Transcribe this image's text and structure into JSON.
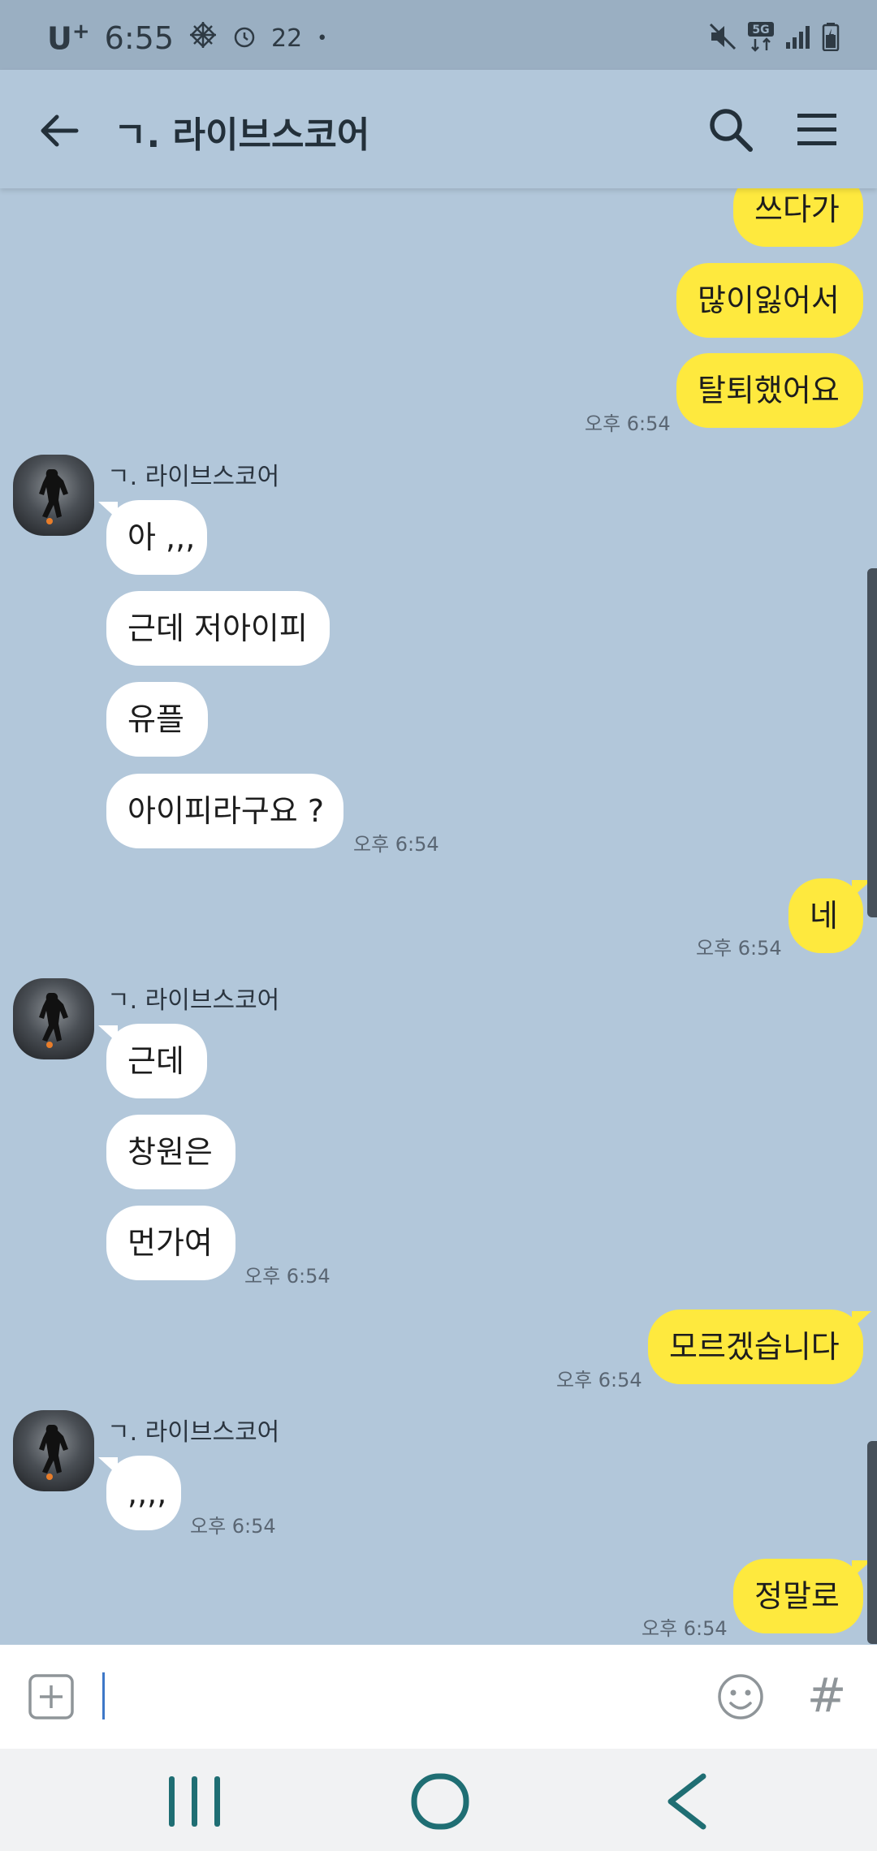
{
  "status_bar": {
    "carrier": "U",
    "carrier_sup": "+",
    "time": "6:55",
    "notification_count": "22",
    "dot": "•",
    "icons": [
      "settings-snowflake-icon",
      "alarm-icon",
      "mute-icon",
      "5g-icon",
      "signal-icon",
      "battery-icon"
    ]
  },
  "header": {
    "title": "ㄱ. 라이브스코어",
    "icons": [
      "back-arrow-icon",
      "search-icon",
      "hamburger-menu-icon"
    ]
  },
  "messages": [
    {
      "side": "mine",
      "text": "쓰다가",
      "time": ""
    },
    {
      "side": "mine",
      "text": "많이잃어서",
      "time": ""
    },
    {
      "side": "mine",
      "text": "탈퇴했어요",
      "time": "오후 6:54"
    },
    {
      "side": "theirs",
      "sender": "ㄱ. 라이브스코어",
      "texts": [
        "아 ,,,",
        "근데 저아이피",
        "유플",
        "아이피라구요 ?"
      ],
      "time": "오후 6:54"
    },
    {
      "side": "mine",
      "text": "네",
      "time": "오후 6:54"
    },
    {
      "side": "theirs",
      "sender": "ㄱ. 라이브스코어",
      "texts": [
        "근데",
        "창원은",
        "먼가여"
      ],
      "time": "오후 6:54"
    },
    {
      "side": "mine",
      "text": "모르겠습니다",
      "time": "오후 6:54"
    },
    {
      "side": "theirs",
      "sender": "ㄱ. 라이브스코어",
      "texts": [
        ",,,,"
      ],
      "time": "오후 6:54"
    },
    {
      "side": "mine",
      "text": "정말로",
      "time": "오후 6:54"
    }
  ],
  "input": {
    "value": "",
    "hash_label": "#",
    "icons": [
      "plus-box-icon",
      "emoji-icon"
    ]
  },
  "nav": {
    "icons": [
      "recents-icon",
      "home-icon",
      "back-icon"
    ]
  },
  "colors": {
    "chat_bg": "#b2c7da",
    "my_bubble": "#fee93e",
    "their_bubble": "#ffffff"
  }
}
